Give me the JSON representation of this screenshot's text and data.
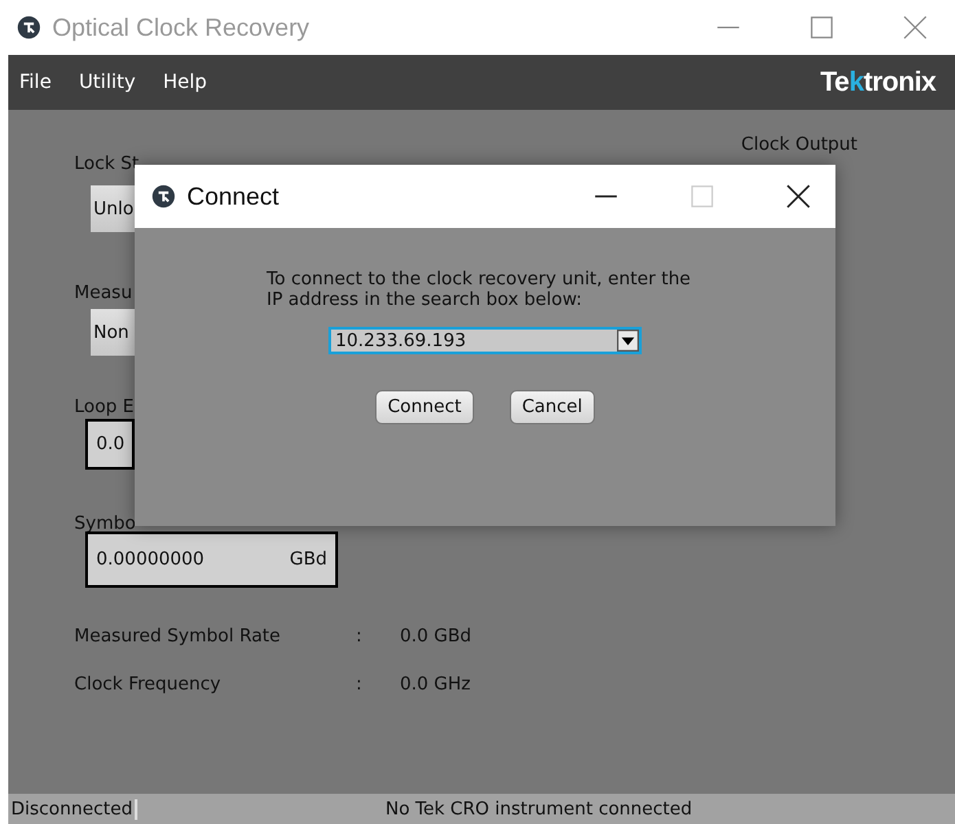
{
  "window": {
    "title": "Optical Clock Recovery"
  },
  "menu": [
    {
      "label": "File"
    },
    {
      "label": "Utility"
    },
    {
      "label": "Help"
    }
  ],
  "brand": {
    "before": "Te",
    "accent": "k",
    "after": "tronix"
  },
  "panel": {
    "lock_label": "Lock St",
    "lock_value": "Unlo",
    "measure_label": "Measu",
    "measure_value": "Non",
    "loop_label": "Loop E",
    "loop_value": "0.0",
    "symbol_label": "Symbo",
    "symbol_value": "0.00000000",
    "symbol_unit": "GBd",
    "clock_output_label": "Clock Output",
    "readings": [
      {
        "label": "Measured Symbol Rate",
        "sep": ":",
        "value": "0.0 GBd"
      },
      {
        "label": "Clock Frequency",
        "sep": ":",
        "value": "0.0 GHz"
      }
    ]
  },
  "dialog": {
    "title": "Connect",
    "message": "To connect to the clock recovery unit, enter the IP address in the search box below:",
    "address": "10.233.69.193",
    "buttons": [
      "Connect",
      "Cancel"
    ]
  },
  "status_bar": {
    "state": "Disconnected",
    "message": "No Tek CRO instrument connected"
  }
}
